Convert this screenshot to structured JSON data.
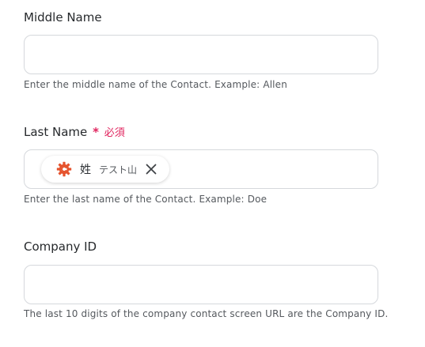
{
  "fields": [
    {
      "label": "Middle Name",
      "value": "",
      "hint": "Enter the middle name of the Contact. Example: Allen"
    },
    {
      "label": "Last Name",
      "required_mark": "*",
      "required_text": "必須",
      "chip": {
        "icon": "gear-cog-icon",
        "name": "姓",
        "value": "テスト山"
      },
      "hint": "Enter the last name of the Contact. Example: Doe"
    },
    {
      "label": "Company ID",
      "value": "",
      "hint": "The last 10 digits of the company contact screen URL are the Company ID."
    }
  ],
  "colors": {
    "required": "#e0245e",
    "chip_icon": "#e5532d",
    "border": "#d5d8dc"
  }
}
